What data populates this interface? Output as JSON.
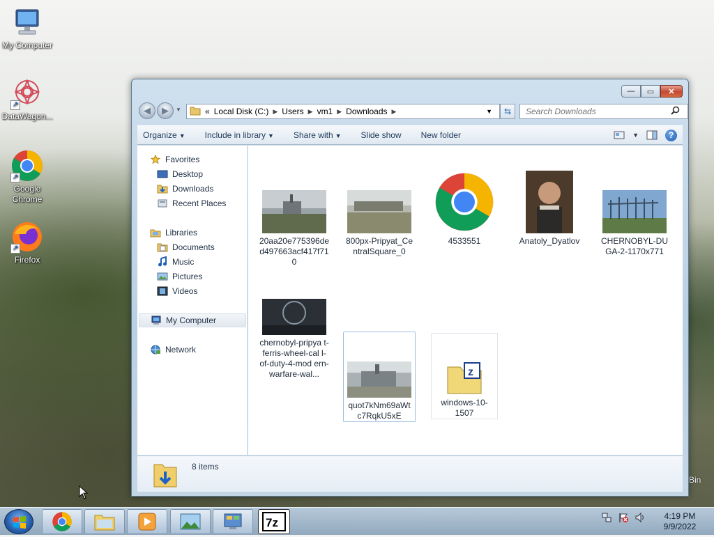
{
  "desktop": {
    "icons": [
      {
        "label": "My Computer"
      },
      {
        "label": "DataWagon..."
      },
      {
        "label": "Google Chrome"
      },
      {
        "label": "Firefox"
      }
    ],
    "recycle_bin_partial": "Bin"
  },
  "window": {
    "caption": {
      "minimize": "—",
      "maximize": "▭",
      "close": "✕"
    },
    "address": {
      "overflow": "«",
      "crumbs": [
        "Local Disk (C:)",
        "Users",
        "vm1",
        "Downloads"
      ]
    },
    "search": {
      "placeholder": "Search Downloads"
    },
    "toolbar": {
      "organize": "Organize",
      "include_in_library": "Include in library",
      "share_with": "Share with",
      "slide_show": "Slide show",
      "new_folder": "New folder"
    },
    "nav": {
      "favorites": "Favorites",
      "desktop": "Desktop",
      "downloads": "Downloads",
      "recent_places": "Recent Places",
      "libraries": "Libraries",
      "documents": "Documents",
      "music": "Music",
      "pictures": "Pictures",
      "videos": "Videos",
      "my_computer": "My Computer",
      "network": "Network"
    },
    "files": [
      {
        "name": "20aa20e775396de d497663acf417f71 0"
      },
      {
        "name": "800px-Pripyat_Ce ntralSquare_0"
      },
      {
        "name": "4533551"
      },
      {
        "name": "Anatoly_Dyatlov"
      },
      {
        "name": "CHERNOBYL-DU GA-2-1170x771"
      },
      {
        "name": "chernobyl-pripya t-ferris-wheel-cal l-of-duty-4-mod ern-warfare-wal..."
      },
      {
        "name": "quot7kNm69aWt c7RqkU5xE"
      },
      {
        "name": "windows-10-1507"
      }
    ],
    "details": {
      "count": "8 items"
    }
  },
  "taskbar": {
    "clock": {
      "time": "4:19 PM",
      "date": "9/9/2022"
    }
  }
}
